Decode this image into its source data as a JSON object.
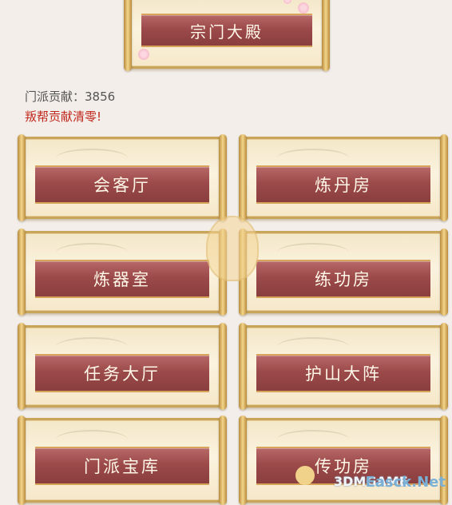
{
  "header": {
    "title": "宗门大殿"
  },
  "stats": {
    "contribution_label": "门派贡献：",
    "contribution_value": "3856",
    "warning": "叛帮贡献清零!"
  },
  "buildings": [
    {
      "label": "会客厅"
    },
    {
      "label": "炼丹房"
    },
    {
      "label": "炼器室"
    },
    {
      "label": "练功房"
    },
    {
      "label": "任务大厅"
    },
    {
      "label": "护山大阵"
    },
    {
      "label": "门派宝库"
    },
    {
      "label": "传功房"
    }
  ],
  "watermark": {
    "site_a": "3DMGAME",
    "site_b": "Easck.Net"
  },
  "colors": {
    "banner": "#9c4a4a",
    "warning": "#c0281e",
    "text": "#555555"
  }
}
